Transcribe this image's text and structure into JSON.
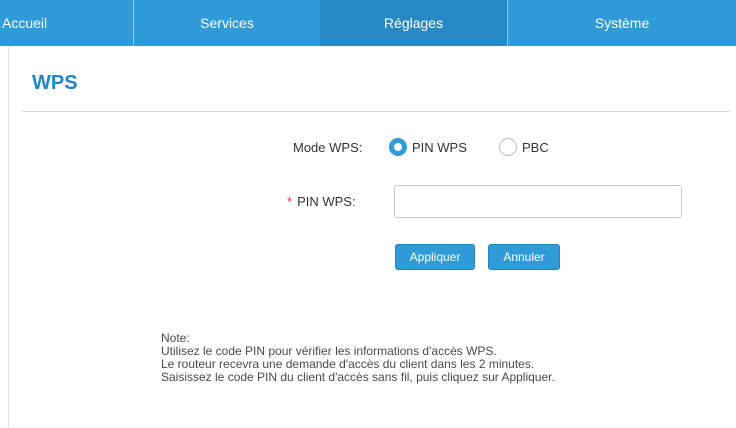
{
  "nav": {
    "items": [
      {
        "label": "Accueil"
      },
      {
        "label": "Services"
      },
      {
        "label": "Réglages"
      },
      {
        "label": "Système"
      }
    ],
    "active_index": 2,
    "color": "#2f9bd8",
    "active_color": "#2789c4"
  },
  "page": {
    "title": "WPS"
  },
  "form": {
    "mode_label": "Mode WPS:",
    "mode_options": [
      {
        "label": "PIN WPS",
        "selected": true
      },
      {
        "label": "PBC",
        "selected": false
      }
    ],
    "pin_required_mark": "*",
    "pin_label": "PIN WPS:",
    "pin_value": "",
    "apply_label": "Appliquer",
    "cancel_label": "Annuler"
  },
  "note": {
    "heading": "Note:",
    "lines": [
      "Utilisez le code PIN pour vérifier les informations d'accès WPS.",
      "Le routeur recevra une demande d'accès du client dans les 2 minutes.",
      "Saisissez le code PIN du client d'accès sans fil, puis cliquez sur Appliquer."
    ]
  },
  "colors": {
    "accent": "#2f9bd8",
    "title": "#1f86c8",
    "required": "#e03a3a"
  }
}
